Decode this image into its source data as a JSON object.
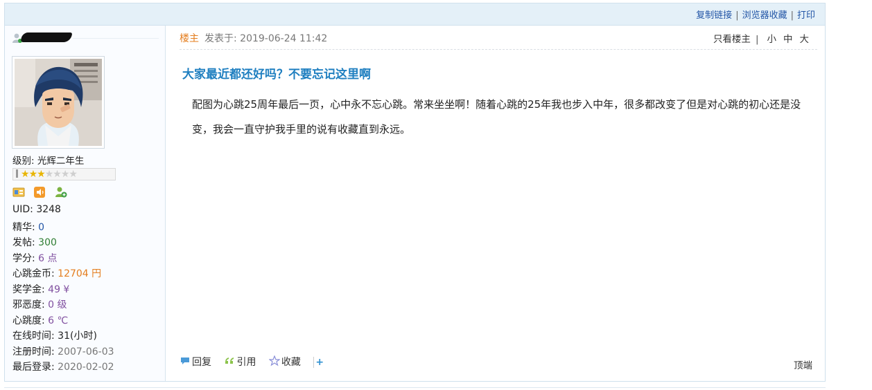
{
  "topbar": {
    "links": [
      "复制链接",
      "浏览器收藏",
      "打印"
    ]
  },
  "user": {
    "level_label": "级别: 光辉二年生",
    "star_rating": 3,
    "star_total": 7,
    "stats": [
      {
        "label": "UID: ",
        "value": "3248",
        "color": "#222222"
      },
      {
        "label": "精华: ",
        "value": "0",
        "color": "#2255a6"
      },
      {
        "label": "发帖: ",
        "value": "300",
        "color": "#2e7d32"
      },
      {
        "label": "学分: ",
        "value": "6 点",
        "color": "#8050a0"
      },
      {
        "label": "心跳金币: ",
        "value": "12704 円",
        "color": "#e47d1d"
      },
      {
        "label": "奖学金: ",
        "value": "49 ¥",
        "color": "#8050a0"
      },
      {
        "label": "邪恶度: ",
        "value": "0 级",
        "color": "#8050a0"
      },
      {
        "label": "心跳度: ",
        "value": "6 ℃",
        "color": "#8050a0"
      },
      {
        "label": "在线时间: ",
        "value": "31(小时)",
        "color": "#222222"
      },
      {
        "label": "注册时间: ",
        "value": "2007-06-03",
        "color": "#777777"
      },
      {
        "label": "最后登录: ",
        "value": "2020-02-02",
        "color": "#777777"
      }
    ]
  },
  "post": {
    "floor": "楼主",
    "posted_at": "发表于: 2019-06-24 11:42",
    "only_op": "只看楼主",
    "sizes": [
      "小",
      "中",
      "大"
    ],
    "title": "大家最近都还好吗？不要忘记这里啊",
    "body": "配图为心跳25周年最后一页，心中永不忘心跳。常来坐坐啊！随着心跳的25年我也步入中年，很多都改变了但是对心跳的初心还是没变，我会一直守护我手里的说有收藏直到永远。",
    "actions": {
      "reply": "回复",
      "quote": "引用",
      "favorite": "收藏"
    },
    "to_top": "顶端"
  },
  "colors": {
    "link": "#2255a6",
    "title": "#1f7fc0",
    "floor": "#e47d1d",
    "topbar_bg": "#e4f0f8"
  }
}
